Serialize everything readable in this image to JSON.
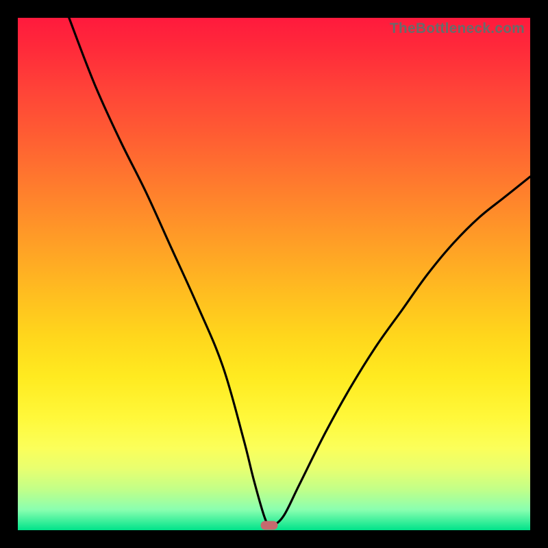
{
  "watermark": "TheBottleneck.com",
  "colors": {
    "background": "#000000",
    "curve_stroke": "#000000",
    "marker": "#c56a6e"
  },
  "chart_data": {
    "type": "line",
    "title": "",
    "xlabel": "",
    "ylabel": "",
    "xlim": [
      0,
      100
    ],
    "ylim": [
      0,
      100
    ],
    "grid": false,
    "legend": false,
    "annotations": [],
    "marker": {
      "x": 49,
      "y": 1
    },
    "series": [
      {
        "name": "bottleneck-curve",
        "x": [
          10,
          15,
          20,
          25,
          30,
          35,
          40,
          44,
          46,
          48,
          49,
          50,
          52,
          55,
          60,
          65,
          70,
          75,
          80,
          85,
          90,
          95,
          100
        ],
        "values": [
          100,
          87,
          76,
          66,
          55,
          44,
          32,
          18,
          10,
          3,
          1,
          1,
          3,
          9,
          19,
          28,
          36,
          43,
          50,
          56,
          61,
          65,
          69
        ]
      }
    ]
  }
}
